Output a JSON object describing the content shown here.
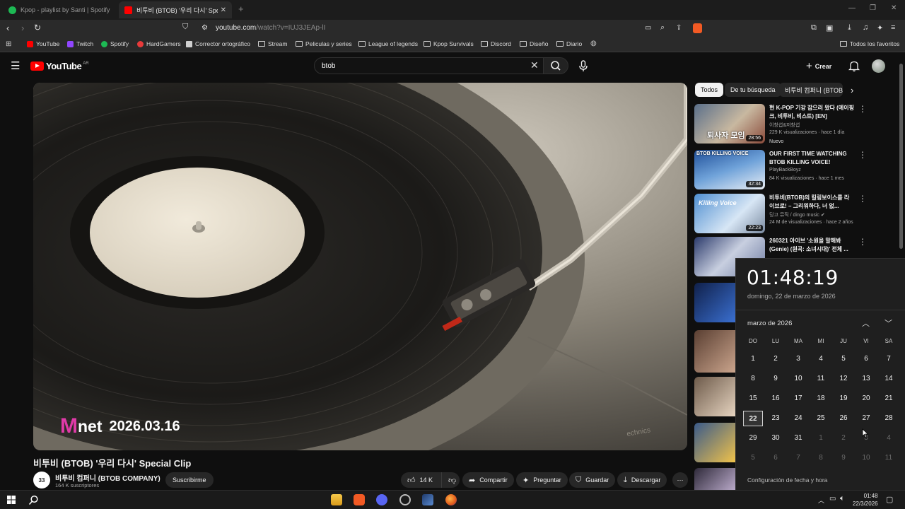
{
  "browser": {
    "tabs": [
      {
        "title": "Kpop - playlist by Santi | Spotify",
        "active": false,
        "color": "#1db954"
      },
      {
        "title": "비투비 (BTOB) '우리 다시' Special",
        "active": true,
        "color": "#ff0000"
      }
    ],
    "url_host": "youtube.com",
    "url_path": "/watch?v=IUJ3JEAp-lI",
    "bookmarks": [
      {
        "label": "YouTube",
        "kind": "site",
        "color": "#ff0000"
      },
      {
        "label": "Twitch",
        "kind": "site",
        "color": "#9146ff"
      },
      {
        "label": "Spotify",
        "kind": "site",
        "color": "#1db954"
      },
      {
        "label": "HardGamers",
        "kind": "site",
        "color": "#e83a3a"
      },
      {
        "label": "Corrector ortográfico",
        "kind": "site",
        "color": "#cfcfcf"
      },
      {
        "label": "Stream",
        "kind": "folder"
      },
      {
        "label": "Peliculas y series",
        "kind": "folder"
      },
      {
        "label": "League of legends",
        "kind": "folder"
      },
      {
        "label": "Kpop Survivals",
        "kind": "folder"
      },
      {
        "label": "Discord",
        "kind": "folder"
      },
      {
        "label": "Diseño",
        "kind": "folder"
      },
      {
        "label": "Diario",
        "kind": "folder"
      }
    ],
    "all_favorites": "Todos los favoritos"
  },
  "youtube": {
    "logo_text": "YouTube",
    "country": "AR",
    "search_value": "btob",
    "create_label": "Crear"
  },
  "video": {
    "overlay_brand_m": "M",
    "overlay_brand_net": "net",
    "overlay_date": "2026.03.16",
    "title": "비투비 (BTOB) '우리 다시' Special Clip",
    "channel": "비투비 컴퍼니 (BTOB COMPANY)",
    "subscribers": "164 K suscriptores",
    "subscribe_label": "Suscribirme",
    "likes": "14 K",
    "share_label": "Compartir",
    "ask_label": "Preguntar",
    "save_label": "Guardar",
    "download_label": "Descargar"
  },
  "chips": [
    "Todos",
    "De tu búsqueda",
    "비투비 컴퍼니 (BTOB"
  ],
  "recommendations": [
    {
      "title": "현 K-POP 기강 잡으러 왔다 (에이핑크, 비투비, 비스트) [EN]",
      "channel": "이창섭&저창섭",
      "meta": "229 K visualizaciones · hace 1 día",
      "badge": "Nuevo",
      "duration": "28:56",
      "thumb_text": "퇴사자 모임"
    },
    {
      "title": "OUR FIRST TIME WATCHING BTOB KILLING VOICE!",
      "channel": "PlayBackBoyz",
      "meta": "84 K visualizaciones · hace 1 mes",
      "badge": "",
      "duration": "32:34",
      "thumb_text": "BTOB KILLING VOICE"
    },
    {
      "title": "비투비(BTOB)의 킬링보이스를 라이브로! – 그리워하다, 너 없...",
      "channel": "딩고 뮤직 / dingo music ✔",
      "meta": "24 M de visualizaciones · hace 2 años",
      "badge": "",
      "duration": "22:23",
      "thumb_text": "Killing Voice"
    },
    {
      "title": "260321 아이브 '소원을 말해봐 (Genie) (원곡: 소녀시대)' 전체 ...",
      "channel": "",
      "meta": "",
      "badge": "",
      "duration": "",
      "thumb_text": ""
    }
  ],
  "clock": {
    "time": "01:48:19",
    "long_date": "domingo, 22 de marzo de 2026",
    "month_label": "marzo de 2026",
    "weekdays": [
      "DO",
      "LU",
      "MA",
      "MI",
      "JU",
      "VI",
      "SA"
    ],
    "days": [
      [
        "1",
        "2",
        "3",
        "4",
        "5",
        "6",
        "7"
      ],
      [
        "8",
        "9",
        "10",
        "11",
        "12",
        "13",
        "14"
      ],
      [
        "15",
        "16",
        "17",
        "18",
        "19",
        "20",
        "21"
      ],
      [
        "22",
        "23",
        "24",
        "25",
        "26",
        "27",
        "28"
      ],
      [
        "29",
        "30",
        "31",
        "1",
        "2",
        "3",
        "4"
      ],
      [
        "5",
        "6",
        "7",
        "8",
        "9",
        "10",
        "11"
      ]
    ],
    "today": "22",
    "settings_link": "Configuración de fecha y hora"
  },
  "taskbar": {
    "time": "01:48",
    "date": "22/3/2026"
  }
}
